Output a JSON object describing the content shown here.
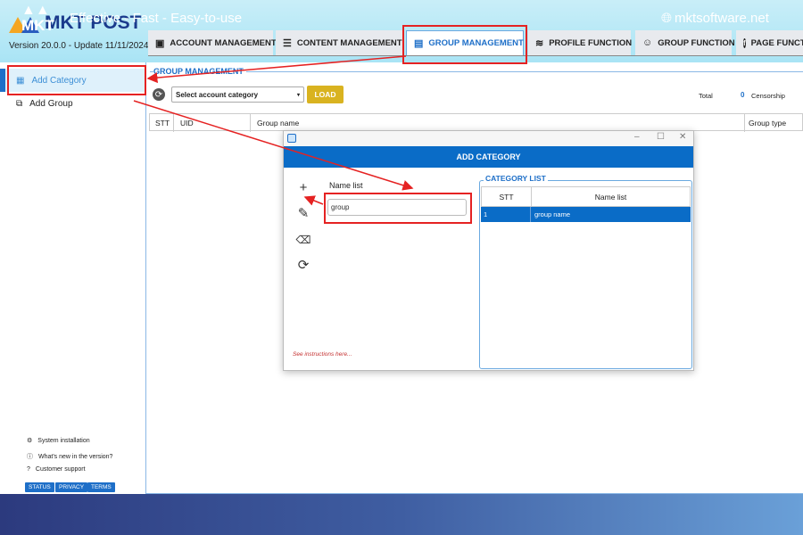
{
  "app": {
    "name": "MKT POST",
    "version": "Version  20.0.0  - Update  11/11/2024"
  },
  "tabs": [
    {
      "label": "ACCOUNT MANAGEMENT",
      "icon": "account-card-icon"
    },
    {
      "label": "CONTENT MANAGEMENT",
      "icon": "list-icon"
    },
    {
      "label": "GROUP MANAGEMENT",
      "icon": "document-icon",
      "active": true
    },
    {
      "label": "PROFILE FUNCTION",
      "icon": "profile-stripes-icon"
    },
    {
      "label": "GROUP FUNCTION",
      "icon": "people-icon"
    },
    {
      "label": "PAGE FUNCTION",
      "icon": "facebook-icon"
    }
  ],
  "sidebar": {
    "items": [
      {
        "label": "Add Category",
        "active": true
      },
      {
        "label": "Add Group"
      }
    ],
    "footer_links": [
      "System installation",
      "What's new in the version?",
      "Customer support"
    ],
    "pills": [
      "STATUS",
      "PRIVACY",
      "TERMS"
    ]
  },
  "main": {
    "section_title": "GROUP MANAGEMENT",
    "select_placeholder": "Select account category",
    "load_label": "LOAD",
    "total_label": "Total",
    "total_value": "0",
    "censorship_label": "Censorship",
    "columns": [
      "STT",
      "UID",
      "Group name",
      "Group type"
    ]
  },
  "dialog": {
    "header": "ADD CATEGORY",
    "name_list_label": "Name list",
    "name_list_value": "group",
    "instructions": "See instructions here...",
    "category_list_title": "CATEGORY LIST",
    "columns": [
      "STT",
      "Name list"
    ],
    "rows": [
      {
        "stt": "1",
        "name": "group name",
        "selected": true
      }
    ]
  },
  "footer": {
    "logo": "MKT",
    "tagline": "Effective - Fast - Easy-to-use",
    "site": "mktsoftware.net"
  },
  "colors": {
    "accent": "#0a6cc7",
    "load": "#d9b320",
    "annotation": "#e52222"
  }
}
